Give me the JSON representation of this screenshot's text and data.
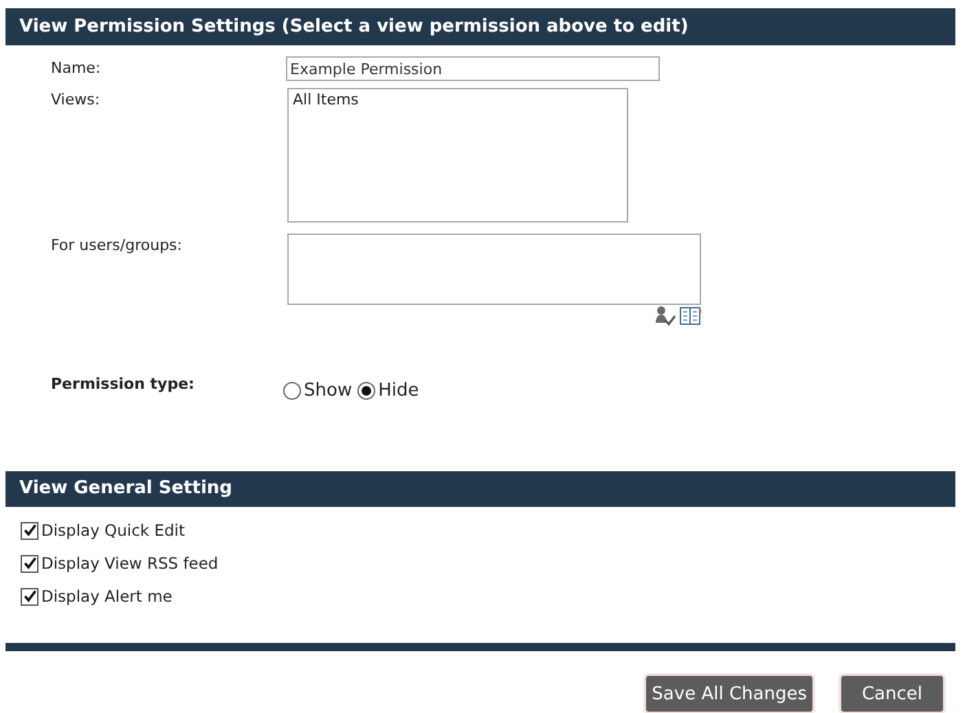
{
  "permission_section": {
    "title": "View Permission Settings (Select a view permission above to edit)",
    "name": {
      "label": "Name:",
      "value": "Example Permission"
    },
    "views": {
      "label": "Views:",
      "items": [
        {
          "label": "All Items",
          "selected": false
        }
      ]
    },
    "users": {
      "label": "For users/groups:"
    },
    "permission_type": {
      "label": "Permission type:",
      "options": [
        {
          "label": "Show",
          "selected": false
        },
        {
          "label": "Hide",
          "selected": true
        }
      ]
    }
  },
  "general_section": {
    "title": "View General Setting",
    "options": [
      {
        "label": "Display Quick Edit",
        "checked": true
      },
      {
        "label": "Display View RSS feed",
        "checked": true
      },
      {
        "label": "Display Alert me",
        "checked": true
      }
    ]
  },
  "buttons": [
    {
      "label": "Save All Changes"
    },
    {
      "label": "Cancel"
    }
  ]
}
